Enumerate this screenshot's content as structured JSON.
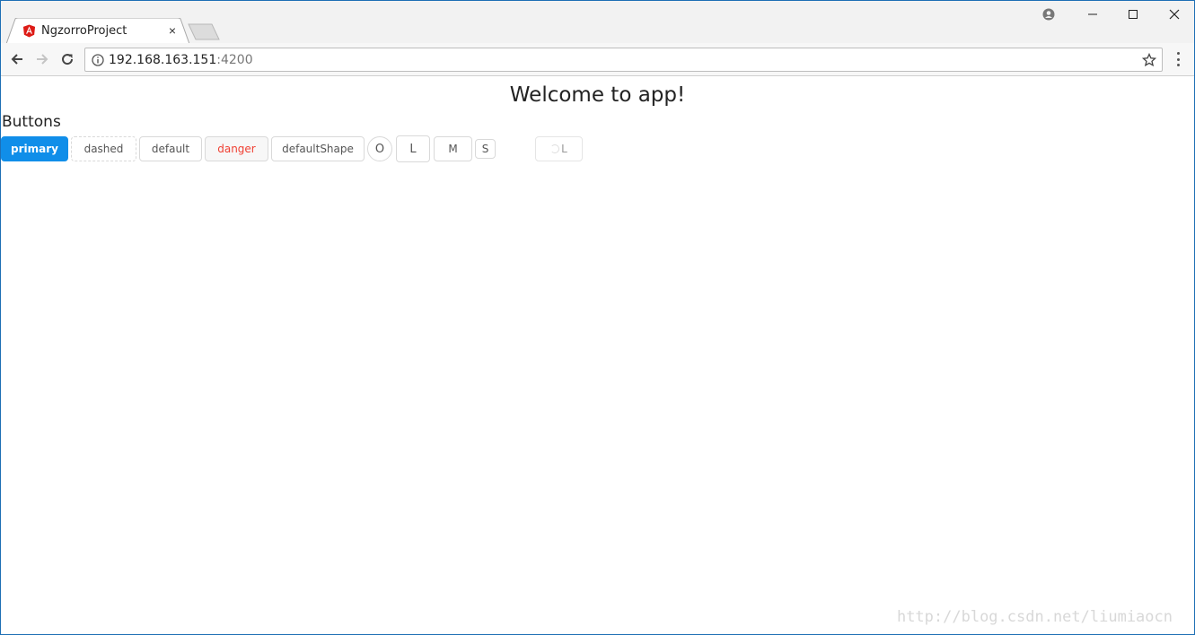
{
  "browser": {
    "tab_title": "NgzorroProject",
    "tab_close": "×",
    "url_host": "192.168.163.151",
    "url_port": ":4200"
  },
  "page": {
    "title": "Welcome to app!",
    "section_title": "Buttons",
    "buttons": {
      "primary": "primary",
      "dashed": "dashed",
      "default": "default",
      "danger": "danger",
      "default_shape": "defaultShape",
      "circle": "O",
      "large": "L",
      "medium": "M",
      "small": "S",
      "loading": "L"
    }
  },
  "watermark": "http://blog.csdn.net/liumiaocn",
  "colors": {
    "primary": "#108ee9",
    "danger": "#f04134",
    "window_border": "#1e6fb5"
  },
  "icons": {
    "favicon": "angular-icon",
    "back": "arrow-left-icon",
    "forward": "arrow-right-icon",
    "reload": "reload-icon",
    "info": "info-icon",
    "bookmark": "star-icon",
    "menu": "kebab-menu-icon",
    "profile": "profile-icon",
    "minimize": "minimize-icon",
    "maximize": "maximize-icon",
    "close": "close-icon",
    "loading": "loading-spinner-icon"
  }
}
